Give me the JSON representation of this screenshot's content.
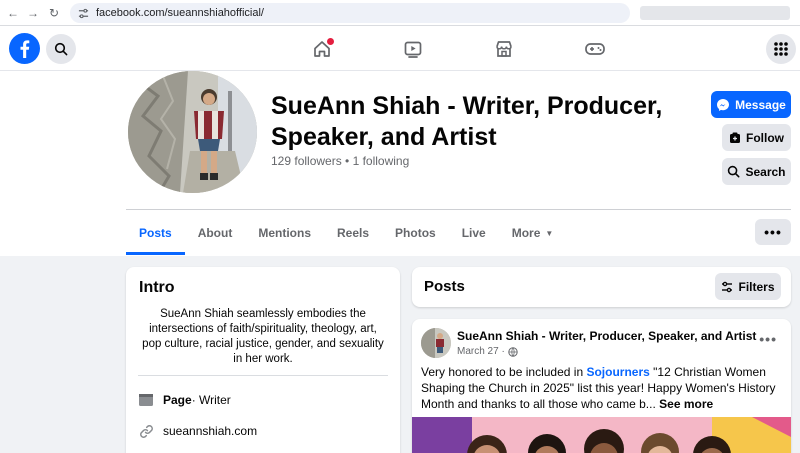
{
  "browser": {
    "url": "facebook.com/sueannshiahofficial/"
  },
  "profile": {
    "name": "SueAnn Shiah - Writer, Producer, Speaker, and Artist",
    "followers": "129 followers • 1 following",
    "buttons": {
      "message": "Message",
      "follow": "Follow",
      "search": "Search"
    }
  },
  "tabs": [
    {
      "label": "Posts",
      "active": true
    },
    {
      "label": "About"
    },
    {
      "label": "Mentions"
    },
    {
      "label": "Reels"
    },
    {
      "label": "Photos"
    },
    {
      "label": "Live"
    },
    {
      "label": "More"
    }
  ],
  "more_dots": "•••",
  "intro": {
    "title": "Intro",
    "bio": "SueAnn Shiah seamlessly embodies the intersections of faith/spirituality, theology, art, pop culture, racial justice, gender, and sexuality in her work.",
    "page_label": "Page",
    "page_category": " · Writer",
    "website": "sueannshiah.com"
  },
  "posts_header": {
    "title": "Posts",
    "filters": "Filters"
  },
  "post": {
    "author": "SueAnn Shiah - Writer, Producer, Speaker, and Artist",
    "date": "March 27 ·",
    "text_before": "Very honored to be included in ",
    "link": "Sojourners",
    "text_after": " \"12 Christian Women Shaping the Church in 2025\" list this year! Happy Women's History Month and thanks to all those who came b... ",
    "see_more": "See more",
    "dots": "•••"
  },
  "colors": {
    "fb_blue": "#0866ff",
    "background": "#f0f2f5",
    "notification": "#e41e3f"
  },
  "icons": {
    "top_nav": [
      "home-icon",
      "video-icon",
      "marketplace-icon",
      "gaming-icon"
    ]
  }
}
